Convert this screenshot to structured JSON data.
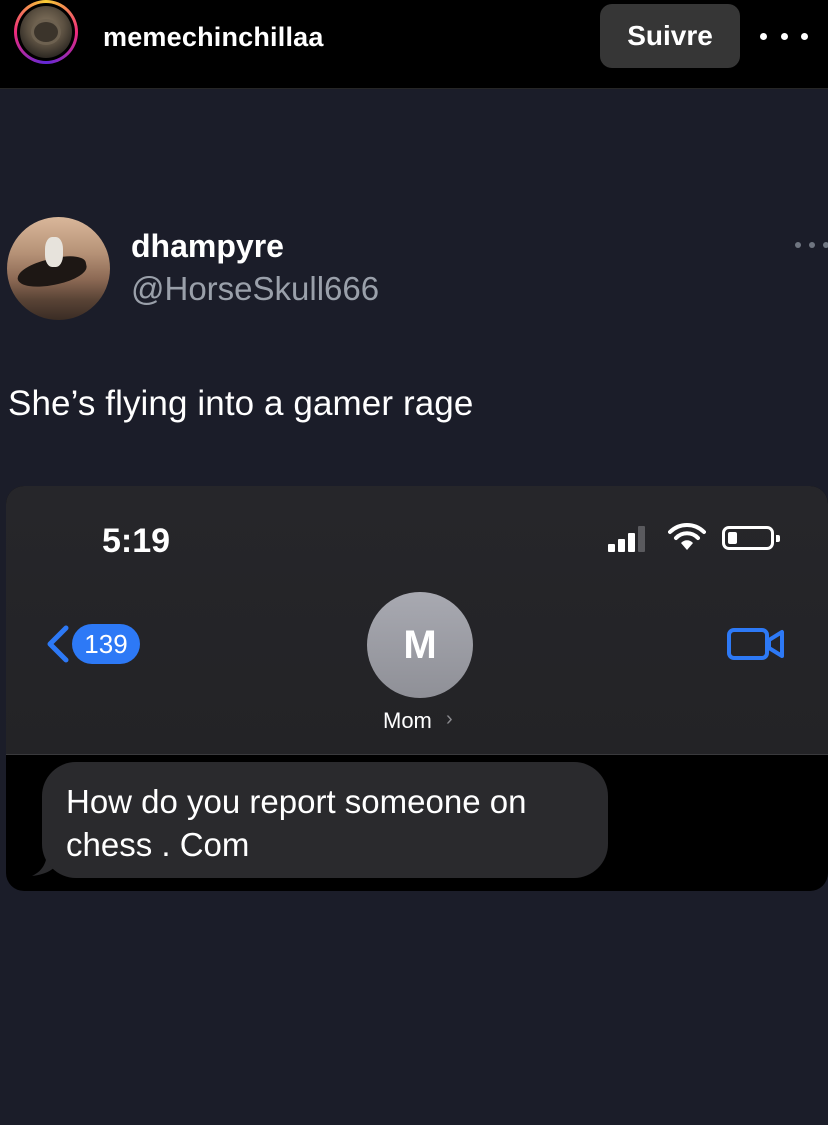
{
  "instagram_header": {
    "username": "memechinchillaa",
    "follow_label": "Suivre",
    "more_icon": "more-horizontal-icon"
  },
  "tweet": {
    "display_name": "dhampyre",
    "handle": "@HorseSkull666",
    "text": "She’s flying into a gamer rage",
    "more_icon": "more-horizontal-icon"
  },
  "phone_screenshot": {
    "status_bar": {
      "time": "5:19",
      "icons": [
        "signal-icon",
        "wifi-icon",
        "battery-icon"
      ]
    },
    "nav": {
      "unread_count": "139",
      "back_icon": "chevron-left-icon",
      "contact_initial": "M",
      "contact_name": "Mom",
      "contact_chevron": "›",
      "video_icon": "video-camera-icon"
    },
    "message": {
      "line1": "How do you report someone on",
      "line2": "chess . Com"
    }
  },
  "colors": {
    "background": "#1b1d29",
    "imessage_blue": "#2d79f6",
    "bubble_gray": "#2a2a2d",
    "handle_gray": "#9aa0aa"
  }
}
